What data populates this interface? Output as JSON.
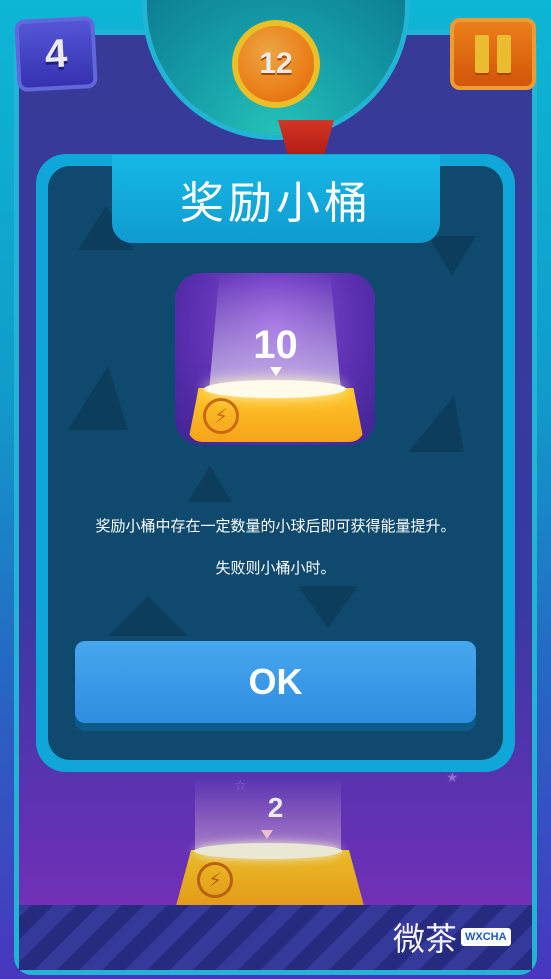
{
  "hud": {
    "level": "4",
    "score": "12",
    "pause_icon": "pause-icon"
  },
  "reward_dialog": {
    "title": "奖励小桶",
    "bucket_count": "10",
    "description_line1": "奖励小桶中存在一定数量的小球后即可获得能量提升。",
    "description_line2": "失败则小桶小时。",
    "ok_label": "OK"
  },
  "bottom_bucket": {
    "count": "2"
  },
  "watermark": {
    "text_cn": "微茶",
    "text_en": "WXCHA"
  },
  "colors": {
    "dialog_frame": "#0fa6d9",
    "dialog_body": "#0f4a6e",
    "ok_button": "#3a9be8",
    "coin": "#ff8a1c",
    "bucket": "#ffc72a"
  }
}
